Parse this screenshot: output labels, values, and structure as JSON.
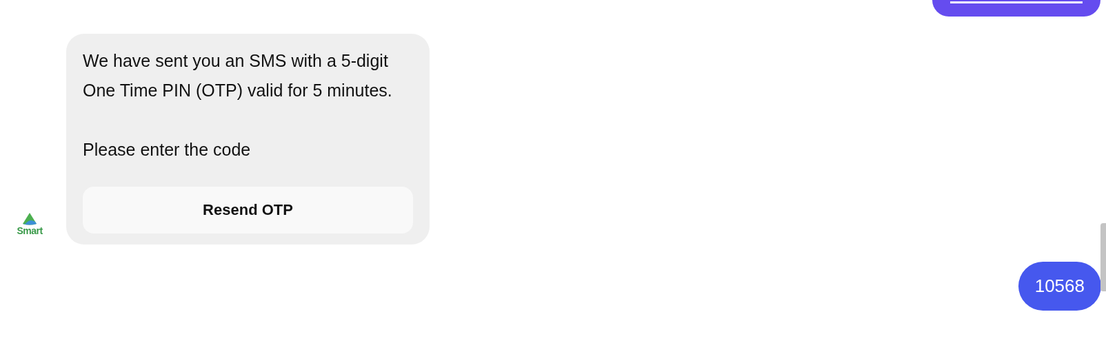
{
  "messages": [
    {
      "kind": "user_cut"
    },
    {
      "kind": "bot",
      "paragraphs": [
        "We have sent you an SMS with a 5-digit One Time PIN (OTP) valid for 5 minutes.",
        "Please enter the code"
      ],
      "button": "Resend OTP",
      "avatar": "Smart"
    },
    {
      "kind": "user",
      "text": "10568"
    }
  ]
}
